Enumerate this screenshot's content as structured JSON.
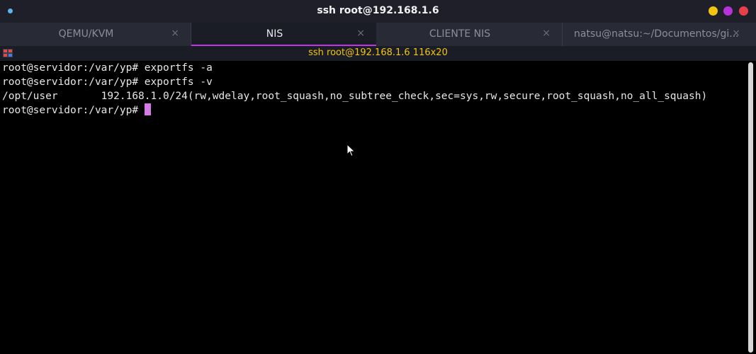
{
  "window": {
    "title": "ssh root@192.168.1.6"
  },
  "tabs": [
    {
      "label": "QEMU/KVM",
      "active": false,
      "close": "×"
    },
    {
      "label": "NIS",
      "active": true,
      "close": "×"
    },
    {
      "label": "CLIENTE NIS",
      "active": false,
      "close": "×"
    },
    {
      "label": "natsu@natsu:~/Documentos/gi...",
      "active": false,
      "close": "×"
    }
  ],
  "session": {
    "title": "ssh root@192.168.1.6 116x20"
  },
  "terminal": {
    "lines": [
      "root@servidor:/var/yp# exportfs -a",
      "root@servidor:/var/yp# exportfs -v",
      "/opt/user       192.168.1.0/24(rw,wdelay,root_squash,no_subtree_check,sec=sys,rw,secure,root_squash,no_all_squash)",
      "root@servidor:/var/yp#"
    ]
  },
  "colors": {
    "accent": "#bd37e0",
    "info_title": "#f1c40f",
    "cursor": "#d57be6",
    "minimize": "#f1c40f",
    "maximize": "#b832d9",
    "close": "#e8404a"
  },
  "icons": [
    "menu-icon",
    "terminal-icon",
    "close-icon",
    "mouse-pointer-icon"
  ]
}
